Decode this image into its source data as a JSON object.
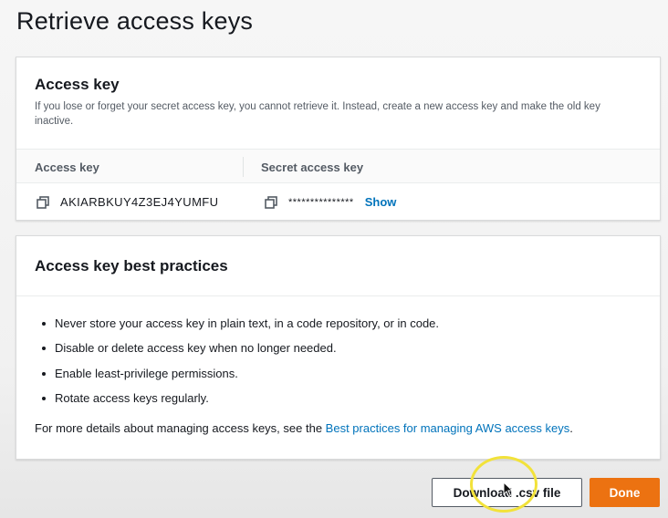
{
  "page": {
    "title": "Retrieve access keys"
  },
  "access_key_panel": {
    "title": "Access key",
    "description": "If you lose or forget your secret access key, you cannot retrieve it. Instead, create a new access key and make the old key inactive.",
    "columns": {
      "access_key": "Access key",
      "secret_access_key": "Secret access key"
    },
    "row": {
      "access_key": "AKIARBKUY4Z3EJ4YUMFU",
      "secret_masked": "***************",
      "show_label": "Show"
    },
    "icons": {
      "copy": "copy-icon"
    }
  },
  "best_practices_panel": {
    "title": "Access key best practices",
    "items": [
      "Never store your access key in plain text, in a code repository, or in code.",
      "Disable or delete access key when no longer needed.",
      "Enable least-privilege permissions.",
      "Rotate access keys regularly."
    ],
    "footer_prefix": "For more details about managing access keys, see the ",
    "footer_link": "Best practices for managing AWS access keys",
    "footer_suffix": "."
  },
  "actions": {
    "download_label": "Download .csv file",
    "done_label": "Done"
  },
  "colors": {
    "link": "#0073bb",
    "primary": "#ec7211",
    "text": "#16191f",
    "highlight_ring": "#f2e23a"
  }
}
